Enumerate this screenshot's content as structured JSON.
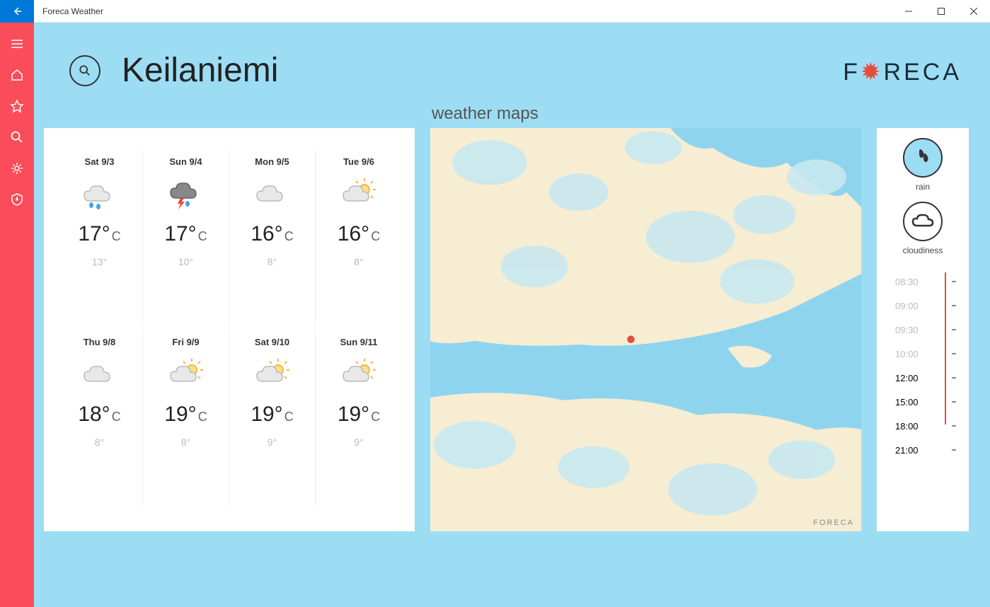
{
  "window": {
    "title": "Foreca Weather"
  },
  "header": {
    "city": "Keilaniemi",
    "brand_pre": "F",
    "brand_post": "RECA"
  },
  "maps_title": "weather maps",
  "forecast": [
    {
      "date": "Sat 9/3",
      "hi": "17°",
      "lo": "13°",
      "icon": "rain"
    },
    {
      "date": "Sun 9/4",
      "hi": "17°",
      "lo": "10°",
      "icon": "storm"
    },
    {
      "date": "Mon 9/5",
      "hi": "16°",
      "lo": "8°",
      "icon": "cloudy"
    },
    {
      "date": "Tue 9/6",
      "hi": "16°",
      "lo": "8°",
      "icon": "partly"
    },
    {
      "date": "Thu 9/8",
      "hi": "18°",
      "lo": "8°",
      "icon": "cloudy"
    },
    {
      "date": "Fri 9/9",
      "hi": "19°",
      "lo": "8°",
      "icon": "partly"
    },
    {
      "date": "Sat 9/10",
      "hi": "19°",
      "lo": "9°",
      "icon": "partly"
    },
    {
      "date": "Sun 9/11",
      "hi": "19°",
      "lo": "9°",
      "icon": "partly"
    }
  ],
  "controls": {
    "layer1": "rain",
    "layer2": "cloudiness"
  },
  "timeline": [
    {
      "t": "08:30",
      "dim": true
    },
    {
      "t": "09:00",
      "dim": true
    },
    {
      "t": "09:30",
      "dim": true
    },
    {
      "t": "10:00",
      "dim": true
    },
    {
      "t": "12:00",
      "dim": false
    },
    {
      "t": "15:00",
      "dim": false
    },
    {
      "t": "18:00",
      "dim": false
    },
    {
      "t": "21:00",
      "dim": false
    }
  ],
  "map_brand": "FORECA",
  "temp_unit": "C"
}
